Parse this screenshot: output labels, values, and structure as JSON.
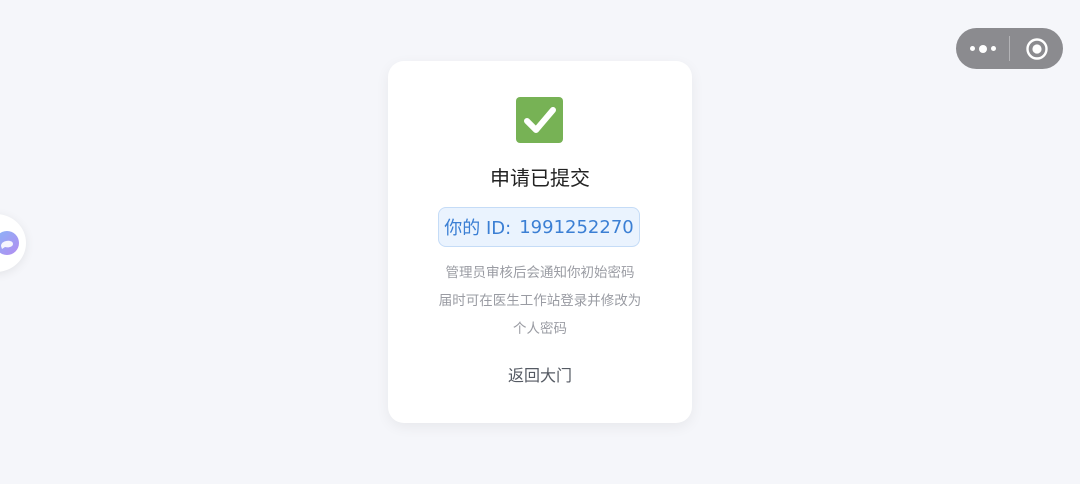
{
  "capsule": {
    "more_icon": "more-dots-icon",
    "close_icon": "record-circle-icon"
  },
  "assistant": {
    "icon": "chat-bubble-icon",
    "colors": [
      "#8ab4f8",
      "#b38cf0"
    ]
  },
  "card": {
    "success_icon": "check-mark-icon",
    "success_color": "#77b255",
    "title": "申请已提交",
    "id_label": "你的 ID:",
    "id_value": "1991252270",
    "notice_lines": [
      "管理员审核后会通知你初始密码",
      "届时可在医生工作站登录并修改为",
      "个人密码"
    ],
    "back_label": "返回大门"
  },
  "colors": {
    "background": "#f5f6fa",
    "accent": "#3b7fd4",
    "capsule": "#8b8b8f"
  }
}
